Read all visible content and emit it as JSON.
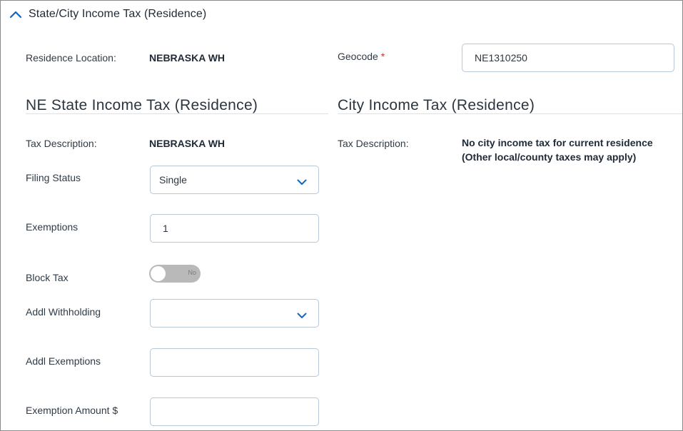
{
  "section": {
    "title": "State/City Income Tax (Residence)",
    "toggle_icon": "chevron-up-icon"
  },
  "residence": {
    "location_label": "Residence Location:",
    "location_value": "NEBRASKA WH",
    "geocode_label": "Geocode",
    "geocode_required_mark": "*",
    "geocode_value": "NE1310250"
  },
  "state_tax": {
    "heading": "NE State Income Tax (Residence)",
    "tax_description_label": "Tax Description:",
    "tax_description_value": "NEBRASKA WH",
    "filing_status_label": "Filing Status",
    "filing_status_value": "Single",
    "exemptions_label": "Exemptions",
    "exemptions_value": "1",
    "block_tax_label": "Block Tax",
    "block_tax_toggle_text": "No",
    "addl_withholding_label": "Addl Withholding",
    "addl_withholding_value": "",
    "addl_exemptions_label": "Addl Exemptions",
    "addl_exemptions_value": "",
    "exemption_amount_label": "Exemption Amount $",
    "exemption_amount_value": ""
  },
  "city_tax": {
    "heading": "City Income Tax (Residence)",
    "tax_description_label": "Tax Description:",
    "tax_description_line1": "No city income tax for current residence",
    "tax_description_line2": "(Other local/county taxes may apply)"
  },
  "colors": {
    "accent": "#1565c0",
    "required": "#c0392b",
    "toggle_off": "#b9b9b9",
    "field_border": "#b8c7d6"
  }
}
